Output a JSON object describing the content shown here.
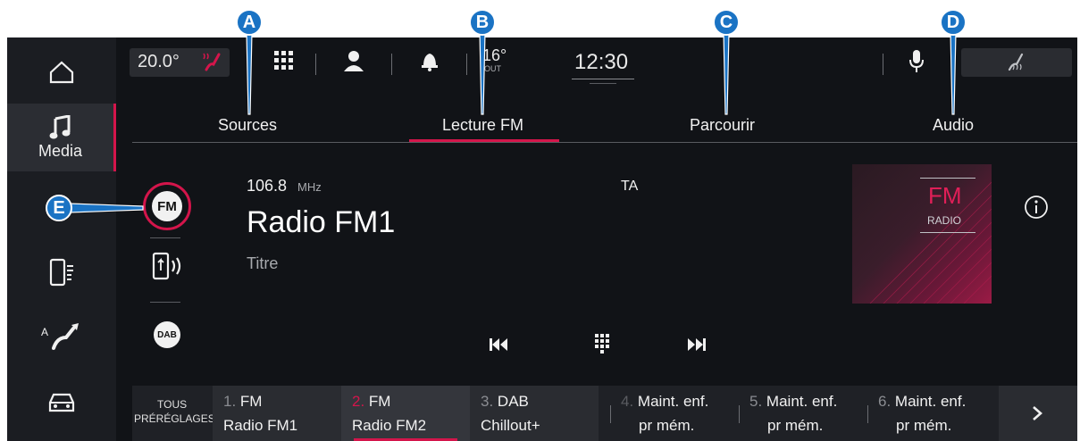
{
  "callouts": [
    "A",
    "B",
    "C",
    "D",
    "E"
  ],
  "topbar": {
    "temperature": "20.0°",
    "outside_temp": "16°",
    "outside_label": "OUT",
    "clock": "12:30"
  },
  "sidebar": {
    "items": [
      {
        "icon": "home-icon"
      },
      {
        "icon": "music-note-icon",
        "label": "Media"
      },
      {
        "icon": "speaker-mute-icon"
      },
      {
        "icon": "phone-icon"
      },
      {
        "icon": "navigation-icon",
        "badge": "A"
      },
      {
        "icon": "car-icon"
      }
    ]
  },
  "tabs": [
    "Sources",
    "Lecture FM",
    "Parcourir",
    "Audio"
  ],
  "sources": [
    "FM",
    "DAB"
  ],
  "station": {
    "frequency": "106.8",
    "unit": "MHz",
    "ta": "TA",
    "name": "Radio FM1",
    "title": "Titre"
  },
  "album_art": {
    "line1": "FM",
    "line2": "RADIO"
  },
  "presets": {
    "all_label_1": "TOUS",
    "all_label_2": "PRÉRÉGLAGES",
    "items": [
      {
        "num": "1.",
        "line1": "FM",
        "line2": "Radio FM1"
      },
      {
        "num": "2.",
        "line1": "FM",
        "line2": "Radio FM2"
      },
      {
        "num": "3.",
        "line1": "DAB",
        "line2": "Chillout+"
      },
      {
        "num": "4.",
        "line1": "Maint. enf.",
        "line2": "pr mém."
      },
      {
        "num": "5.",
        "line1": "Maint. enf.",
        "line2": "pr mém."
      },
      {
        "num": "6.",
        "line1": "Maint. enf.",
        "line2": "pr mém."
      }
    ]
  },
  "colors": {
    "accent": "#d4154b",
    "callout": "#1a73c4",
    "background": "#111317"
  }
}
